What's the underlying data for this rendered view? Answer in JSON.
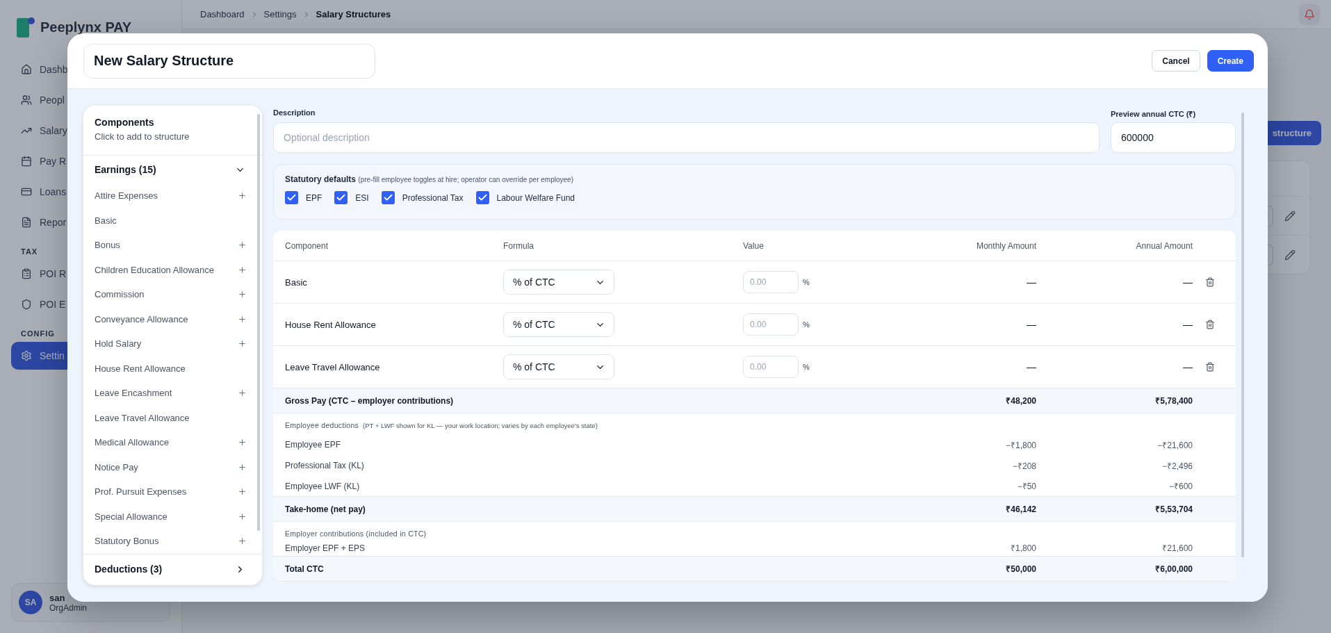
{
  "background": {
    "logo": "Peeplynx PAY",
    "breadcrumb": [
      "Dashboard",
      "Settings",
      "Salary Structures"
    ],
    "nav": [
      {
        "kind": "item",
        "label": "Dashb",
        "selected": false
      },
      {
        "kind": "item",
        "label": "Peopl",
        "selected": false
      },
      {
        "kind": "item",
        "label": "Salary",
        "selected": false
      },
      {
        "kind": "item",
        "label": "Pay R",
        "selected": false
      },
      {
        "kind": "item",
        "label": "Loans",
        "selected": false
      },
      {
        "kind": "item",
        "label": "Repor",
        "selected": false
      },
      {
        "kind": "section",
        "label": "TAX"
      },
      {
        "kind": "item",
        "label": "POI R",
        "selected": false
      },
      {
        "kind": "item",
        "label": "POI E",
        "selected": false
      },
      {
        "kind": "section",
        "label": "CONFIG"
      },
      {
        "kind": "item",
        "label": "Settin",
        "selected": true
      }
    ],
    "user": {
      "initials": "SA",
      "name": "san",
      "role": "OrgAdmin"
    },
    "action_button": "structure"
  },
  "modal": {
    "title_value": "New Salary Structure",
    "buttons": [
      {
        "kind": "secondary",
        "label": "Cancel"
      },
      {
        "kind": "primary",
        "label": "Create"
      }
    ],
    "components_panel": {
      "title": "Components",
      "subtitle": "Click to add to structure",
      "groups": [
        {
          "label": "Earnings (15)",
          "expanded": true,
          "items": [
            {
              "label": "Attire Expenses",
              "added": false
            },
            {
              "label": "Basic",
              "added": true
            },
            {
              "label": "Bonus",
              "added": false
            },
            {
              "label": "Children Education Allowance",
              "added": false
            },
            {
              "label": "Commission",
              "added": false
            },
            {
              "label": "Conveyance Allowance",
              "added": false
            },
            {
              "label": "Hold Salary",
              "added": false
            },
            {
              "label": "House Rent Allowance",
              "added": true
            },
            {
              "label": "Leave Encashment",
              "added": false
            },
            {
              "label": "Leave Travel Allowance",
              "added": true
            },
            {
              "label": "Medical Allowance",
              "added": false
            },
            {
              "label": "Notice Pay",
              "added": false
            },
            {
              "label": "Prof. Pursuit Expenses",
              "added": false
            },
            {
              "label": "Special Allowance",
              "added": false
            },
            {
              "label": "Statutory Bonus",
              "added": false
            }
          ]
        },
        {
          "label": "Deductions (3)",
          "expanded": false
        }
      ]
    },
    "description": {
      "label": "Description",
      "placeholder": "Optional description"
    },
    "preview_ctc": {
      "label": "Preview annual CTC (₹)",
      "value": "600000"
    },
    "statutory": {
      "title": "Statutory defaults",
      "note": "(pre-fill employee toggles at hire; operator can override per employee)",
      "options": [
        {
          "label": "EPF",
          "checked": true
        },
        {
          "label": "ESI",
          "checked": true
        },
        {
          "label": "Professional Tax",
          "checked": true
        },
        {
          "label": "Labour Welfare Fund",
          "checked": true
        }
      ]
    },
    "table": {
      "columns": [
        "Component",
        "Formula",
        "Value",
        "Monthly Amount",
        "Annual Amount"
      ],
      "rows": [
        {
          "kind": "component",
          "name": "Basic",
          "formula": "% of CTC",
          "value_placeholder": "0.00",
          "unit": "%",
          "monthly": "—",
          "annual": "—"
        },
        {
          "kind": "component",
          "name": "House Rent Allowance",
          "formula": "% of CTC",
          "value_placeholder": "0.00",
          "unit": "%",
          "monthly": "—",
          "annual": "—"
        },
        {
          "kind": "component",
          "name": "Leave Travel Allowance",
          "formula": "% of CTC",
          "value_placeholder": "0.00",
          "unit": "%",
          "monthly": "—",
          "annual": "—"
        },
        {
          "kind": "total",
          "name": "Gross Pay (CTC – employer contributions)",
          "monthly": "₹48,200",
          "annual": "₹5,78,400"
        },
        {
          "kind": "section",
          "name": "Employee deductions",
          "note": "(PT + LWF shown for KL — your work location; varies by each employee's state)"
        },
        {
          "kind": "line",
          "name": "Employee EPF",
          "monthly": "−₹1,800",
          "annual": "−₹21,600"
        },
        {
          "kind": "line",
          "name": "Professional Tax (KL)",
          "monthly": "−₹208",
          "annual": "−₹2,496"
        },
        {
          "kind": "line",
          "name": "Employee LWF (KL)",
          "monthly": "−₹50",
          "annual": "−₹600"
        },
        {
          "kind": "total",
          "name": "Take-home (net pay)",
          "monthly": "₹46,142",
          "annual": "₹5,53,704"
        },
        {
          "kind": "section",
          "name": "Employer contributions (included in CTC)"
        },
        {
          "kind": "line",
          "name": "Employer EPF + EPS",
          "monthly": "₹1,800",
          "annual": "₹21,600"
        },
        {
          "kind": "total",
          "name": "Total CTC",
          "monthly": "₹50,000",
          "annual": "₹6,00,000"
        }
      ]
    }
  }
}
